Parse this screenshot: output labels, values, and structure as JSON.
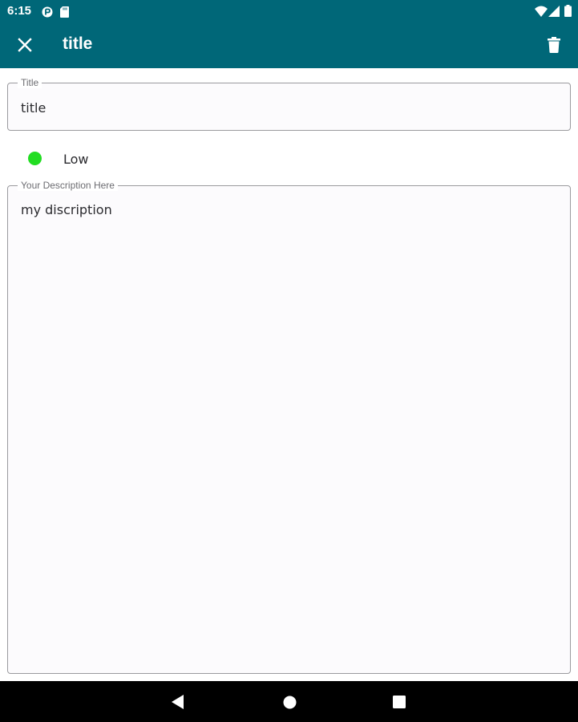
{
  "status_bar": {
    "time": "6:15",
    "left_icons": [
      "data-saver-icon",
      "sd-card-icon"
    ],
    "right_icons": [
      "wifi-icon",
      "cellular-signal-icon",
      "battery-icon"
    ]
  },
  "app_bar": {
    "background": "#006778",
    "title": "title",
    "close_icon": "close-icon",
    "delete_icon": "delete-icon"
  },
  "title_field": {
    "label": "Title",
    "value": "title"
  },
  "priority": {
    "label": "Low",
    "color": "#22dd22"
  },
  "description_field": {
    "label": "Your Description Here",
    "value": "my discription"
  },
  "nav_bar": {
    "buttons": [
      "back-icon",
      "home-icon",
      "recents-icon"
    ]
  }
}
